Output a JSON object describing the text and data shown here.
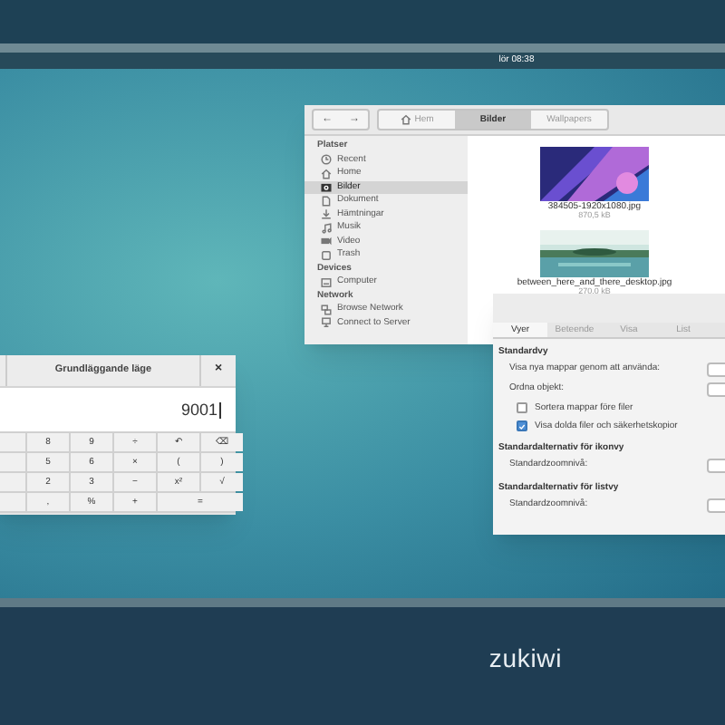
{
  "panel": {
    "clock": "lör 08:38"
  },
  "file_manager": {
    "nav": [
      "←",
      "→"
    ],
    "path": [
      {
        "label": "Hem",
        "selected": false
      },
      {
        "label": "Bilder",
        "selected": true
      },
      {
        "label": "Wallpapers",
        "selected": false
      }
    ],
    "sidebar": [
      {
        "heading": "Platser",
        "items": [
          {
            "label": "Recent",
            "selected": false
          },
          {
            "label": "Home",
            "selected": false
          },
          {
            "label": "Bilder",
            "selected": true
          },
          {
            "label": "Dokument",
            "selected": false
          },
          {
            "label": "Hämtningar",
            "selected": false
          },
          {
            "label": "Musik",
            "selected": false
          },
          {
            "label": "Video",
            "selected": false
          },
          {
            "label": "Trash",
            "selected": false
          }
        ]
      },
      {
        "heading": "Devices",
        "items": [
          {
            "label": "Computer",
            "selected": false
          }
        ]
      },
      {
        "heading": "Network",
        "items": [
          {
            "label": "Browse Network",
            "selected": false
          },
          {
            "label": "Connect to Server",
            "selected": false
          }
        ]
      }
    ],
    "files": [
      {
        "name": "384505-1920x1080.jpg",
        "size": "870,5 kB",
        "kind": "picture"
      },
      {
        "name": "between_here_and_there_desktop.jpg",
        "size": "270,0 kB",
        "kind": "picture"
      }
    ]
  },
  "preferences": {
    "tabs": [
      {
        "label": "Vyer",
        "selected": true
      },
      {
        "label": "Beteende",
        "selected": false
      },
      {
        "label": "Visa",
        "selected": false
      },
      {
        "label": "List",
        "selected": false
      }
    ],
    "sections": [
      {
        "heading": "Standardvy",
        "rows": [
          {
            "kind": "combo",
            "label": "Visa nya mappar genom att använda:"
          },
          {
            "kind": "combo",
            "label": "Ordna objekt:"
          },
          {
            "kind": "check",
            "label": "Sortera mappar före filer",
            "checked": false
          },
          {
            "kind": "check",
            "label": "Visa dolda filer och säkerhetskopior",
            "checked": true
          }
        ]
      },
      {
        "heading": "Standardalternativ för ikonvy",
        "rows": [
          {
            "kind": "combo",
            "label": "Standardzoomnivå:"
          }
        ]
      },
      {
        "heading": "Standardalternativ för listvy",
        "rows": [
          {
            "kind": "combo",
            "label": "Standardzoomnivå:"
          }
        ]
      }
    ]
  },
  "calculator": {
    "title": "Grundläggande läge",
    "close": "×",
    "display": "9001",
    "keys": [
      [
        {
          "label": "8"
        },
        {
          "label": "9"
        },
        {
          "label": "÷"
        },
        {
          "label": "↶"
        },
        {
          "label": "⌫"
        }
      ],
      [
        {
          "label": "5"
        },
        {
          "label": "6"
        },
        {
          "label": "×"
        },
        {
          "label": "("
        },
        {
          "label": ")"
        }
      ],
      [
        {
          "label": "2"
        },
        {
          "label": "3"
        },
        {
          "label": "−"
        },
        {
          "label": "x²"
        },
        {
          "label": "√"
        }
      ],
      [
        {
          "label": ","
        },
        {
          "label": "%"
        },
        {
          "label": "+"
        },
        {
          "label": "=",
          "wide": true
        }
      ]
    ]
  },
  "login": {
    "brand": "zukiwi"
  }
}
